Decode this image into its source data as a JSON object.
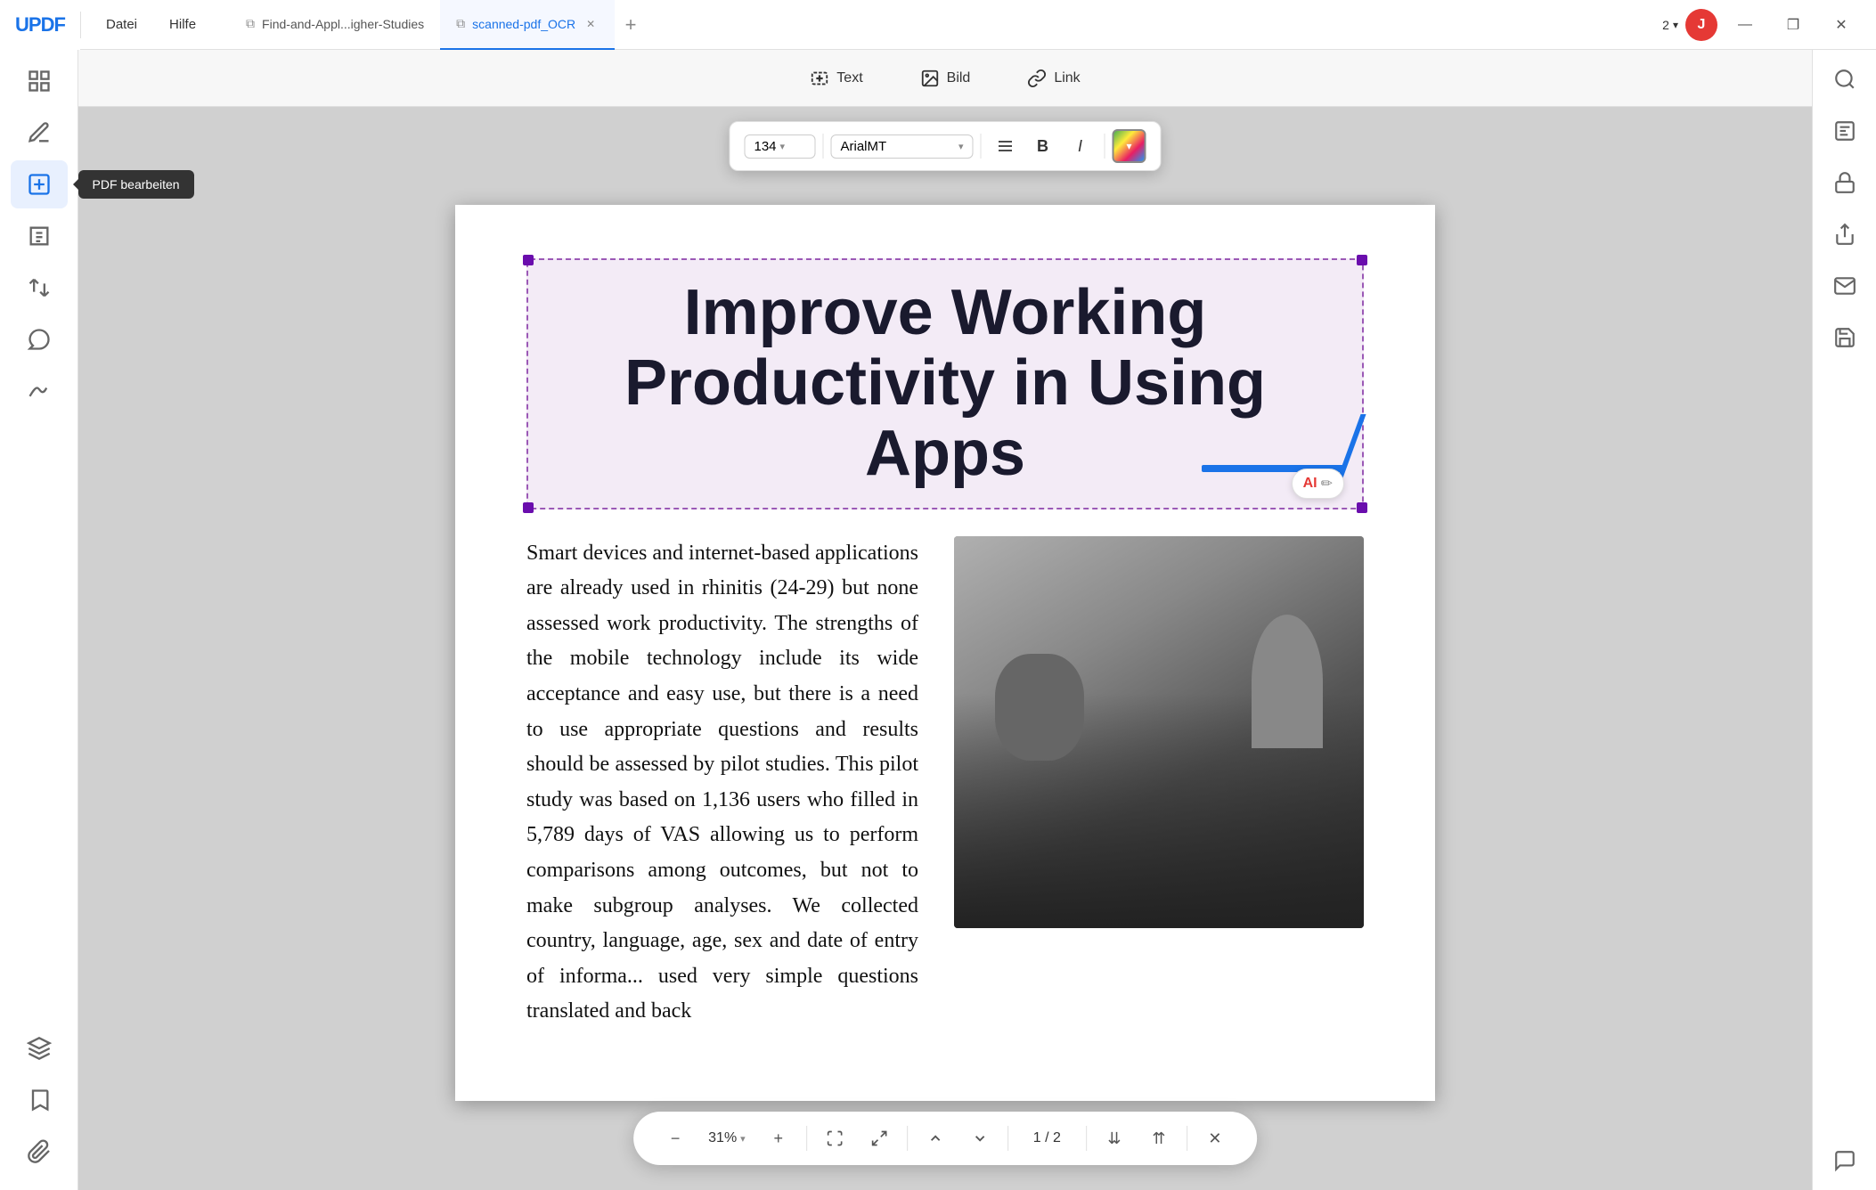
{
  "app": {
    "logo": "UPDF",
    "menus": [
      "Datei",
      "Hilfe"
    ],
    "tabs": [
      {
        "label": "Find-and-Appl...igher-Studies",
        "active": false,
        "closable": false
      },
      {
        "label": "scanned-pdf_OCR",
        "active": true,
        "closable": true
      }
    ],
    "page_num": "2",
    "avatar_letter": "J",
    "win_buttons": [
      "—",
      "❐",
      "✕"
    ]
  },
  "toolbar": {
    "text_label": "Text",
    "bild_label": "Bild",
    "link_label": "Link"
  },
  "format_bar": {
    "font_size": "134",
    "font_name": "ArialMT",
    "bold_label": "B",
    "italic_label": "I"
  },
  "pdf_content": {
    "title": "Improve Working Productivity in Using Apps",
    "body_text": "Smart devices and internet-based applications are already used in rhinitis (24-29) but none assessed work productivity. The strengths of the mobile technology include its wide acceptance and easy use, but there is a need to use appropriate questions and results should be assessed by pilot studies. This pilot study was based on 1,136 users who filled in 5,789 days of VAS allowing us to perform comparisons among outcomes, but not to make subgroup analyses. We collected country, language, age, sex and date of entry of informa... used very simple questions translated and back"
  },
  "bottom_nav": {
    "zoom_minus": "−",
    "zoom_value": "31%",
    "zoom_plus": "+",
    "page_current": "1",
    "page_total": "2",
    "close_label": "✕"
  },
  "sidebar": {
    "tooltip": "PDF bearbeiten"
  },
  "sidebar_left_icons": [
    {
      "name": "panel-icon",
      "symbol": "⊞"
    },
    {
      "name": "edit-icon",
      "symbol": "✏"
    },
    {
      "name": "select-icon",
      "symbol": "☰",
      "active": true
    },
    {
      "name": "pages-icon",
      "symbol": "⊡"
    },
    {
      "name": "convert-icon",
      "symbol": "↔"
    },
    {
      "name": "comment-icon",
      "symbol": "✍"
    },
    {
      "name": "sign-icon",
      "symbol": "✒"
    },
    {
      "name": "layers-icon",
      "symbol": "◈"
    },
    {
      "name": "bookmark-icon",
      "symbol": "🔖"
    },
    {
      "name": "attach-icon",
      "symbol": "📎"
    }
  ],
  "sidebar_right_icons": [
    {
      "name": "search-icon",
      "symbol": "🔍"
    },
    {
      "name": "ocr-icon",
      "symbol": "OCR"
    },
    {
      "name": "protect-icon",
      "symbol": "🔒"
    },
    {
      "name": "share-icon",
      "symbol": "↑"
    },
    {
      "name": "send-icon",
      "symbol": "✉"
    },
    {
      "name": "save-icon",
      "symbol": "⊙"
    },
    {
      "name": "chat-icon",
      "symbol": "💬"
    }
  ],
  "colors": {
    "accent_blue": "#1a73e8",
    "accent_purple": "#9b59b6",
    "title_text": "#1a1a2e",
    "sidebar_bg": "#ffffff",
    "content_bg": "#d0d0d0"
  }
}
